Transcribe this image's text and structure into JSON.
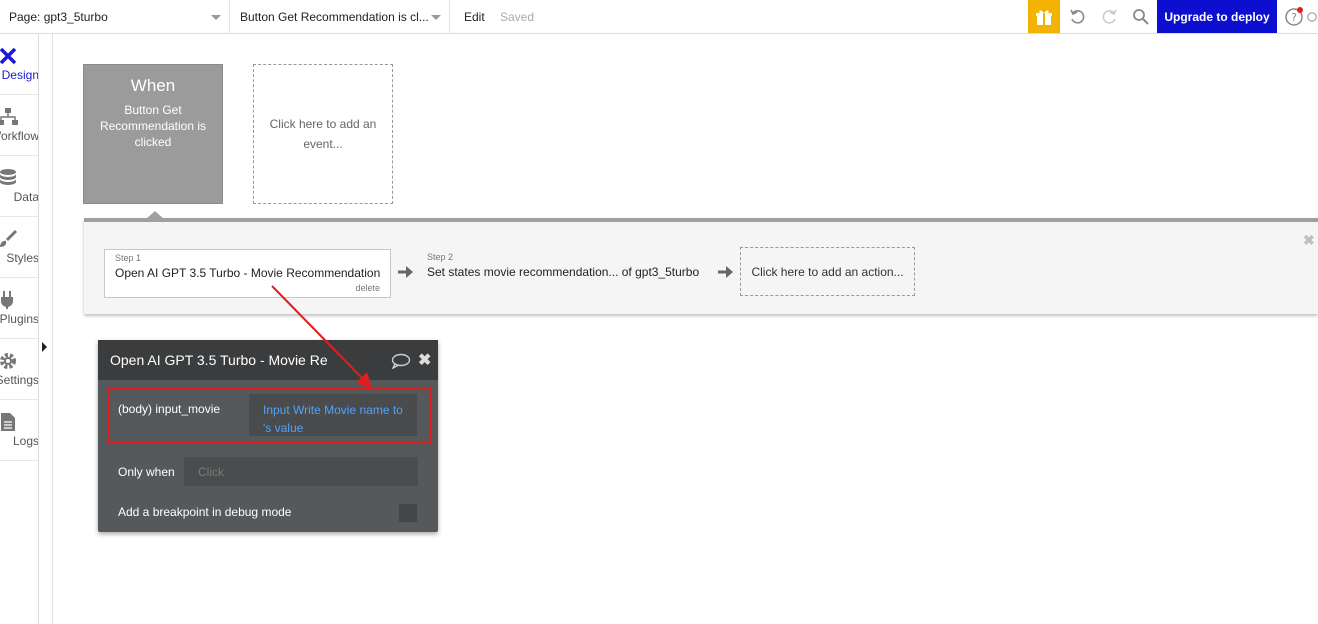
{
  "topbar": {
    "page_select": "Page: gpt3_5turbo",
    "element_select": "Button Get Recommendation is cl...",
    "edit_label": "Edit",
    "saved_label": "Saved",
    "upgrade_label": "Upgrade to deploy"
  },
  "sidebar": {
    "items": [
      {
        "label": "Design"
      },
      {
        "label": "Workflow"
      },
      {
        "label": "Data"
      },
      {
        "label": "Styles"
      },
      {
        "label": "Plugins"
      },
      {
        "label": "Settings"
      },
      {
        "label": "Logs"
      }
    ]
  },
  "event": {
    "when_label": "When",
    "description": "Button Get Recommendation is clicked",
    "add_event_label": "Click here to add an event..."
  },
  "actions": {
    "steps": [
      {
        "num": "Step 1",
        "title": "Open AI GPT 3.5 Turbo - Movie Recommendation",
        "delete_label": "delete"
      },
      {
        "num": "Step 2",
        "title": "Set states movie recommendation... of gpt3_5turbo"
      }
    ],
    "add_action_label": "Click here to add an action..."
  },
  "panel": {
    "title": "Open AI GPT 3.5 Turbo - Movie Re",
    "body_label": "(body) input_movie",
    "body_value": "Input Write Movie name to 's value",
    "only_when_label": "Only when",
    "only_when_placeholder": "Click",
    "breakpoint_label": "Add a breakpoint in debug mode"
  },
  "colors": {
    "accent": "#0c0fd0",
    "gift": "#f5b301",
    "highlight": "#e01e1e",
    "link": "#4da3ff"
  }
}
